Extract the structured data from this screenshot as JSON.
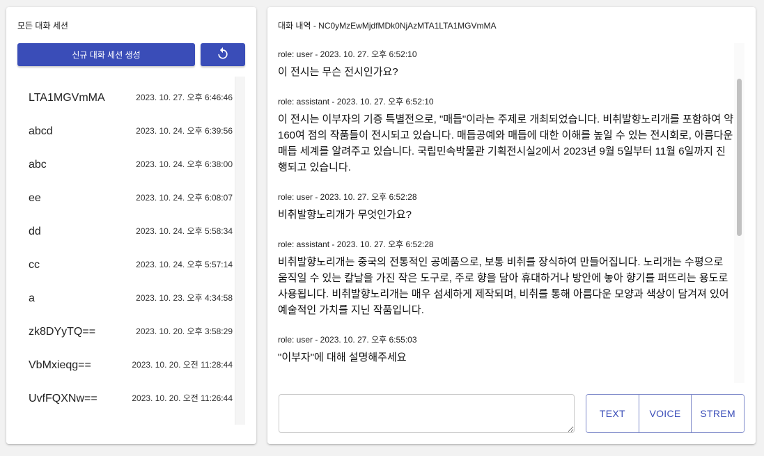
{
  "colors": {
    "primary": "#3a4db8",
    "background": "#f2f2f2"
  },
  "left_panel": {
    "title": "모든 대화 세션",
    "new_session_label": "신규 대화 세션 생성",
    "refresh_icon": "refresh-icon",
    "sessions": [
      {
        "name": "LTA1MGVmMA",
        "time": "2023. 10. 27. 오후 6:46:46"
      },
      {
        "name": "abcd",
        "time": "2023. 10. 24. 오후 6:39:56"
      },
      {
        "name": "abc",
        "time": "2023. 10. 24. 오후 6:38:00"
      },
      {
        "name": "ee",
        "time": "2023. 10. 24. 오후 6:08:07"
      },
      {
        "name": "dd",
        "time": "2023. 10. 24. 오후 5:58:34"
      },
      {
        "name": "cc",
        "time": "2023. 10. 24. 오후 5:57:14"
      },
      {
        "name": "a",
        "time": "2023. 10. 23. 오후 4:34:58"
      },
      {
        "name": "zk8DYyTQ==",
        "time": "2023. 10. 20. 오후 3:58:29"
      },
      {
        "name": "VbMxieqg==",
        "time": "2023. 10. 20. 오전 11:28:44"
      },
      {
        "name": "UvfFQXNw==",
        "time": "2023. 10. 20. 오전 11:26:44"
      }
    ]
  },
  "right_panel": {
    "title": "대화 내역 - NC0yMzEwMjdfMDk0NjAzMTA1LTA1MGVmMA",
    "messages": [
      {
        "meta": "role: user - 2023. 10. 27. 오후 6:52:10",
        "text": "이 전시는 무슨 전시인가요?"
      },
      {
        "meta": "role: assistant - 2023. 10. 27. 오후 6:52:10",
        "text": "이 전시는 이부자의 기증 특별전으로, \"매듭\"이라는 주제로 개최되었습니다. 비취발향노리개를 포함하여 약 160여 점의 작품들이 전시되고 있습니다. 매듭공예와 매듭에 대한 이해를 높일 수 있는 전시회로, 아름다운 매듭 세계를 알려주고 있습니다. 국립민속박물관 기획전시실2에서 2023년 9월 5일부터 11월 6일까지 진행되고 있습니다."
      },
      {
        "meta": "role: user - 2023. 10. 27. 오후 6:52:28",
        "text": "비취발향노리개가 무엇인가요?"
      },
      {
        "meta": "role: assistant - 2023. 10. 27. 오후 6:52:28",
        "text": "비취발향노리개는 중국의 전통적인 공예품으로, 보통 비취를 장식하여 만들어집니다. 노리개는 수평으로 움직일 수 있는 칼날을 가진 작은 도구로, 주로 향을 담아 휴대하거나 방안에 놓아 향기를 퍼뜨리는 용도로 사용됩니다. 비취발향노리개는 매우 섬세하게 제작되며, 비취를 통해 아름다운 모양과 색상이 담겨져 있어 예술적인 가치를 지닌 작품입니다."
      },
      {
        "meta": "role: user - 2023. 10. 27. 오후 6:55:03",
        "text": "\"이부자\"에 대해 설명해주세요"
      }
    ],
    "input_value": "",
    "modes": {
      "text": "TEXT",
      "voice": "VOICE",
      "stream": "STREM"
    }
  }
}
